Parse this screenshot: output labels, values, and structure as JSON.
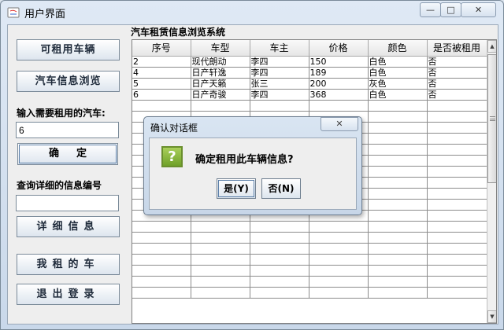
{
  "window": {
    "title": "用户界面",
    "min_label": "—",
    "max_label": "□",
    "close_label": "✕"
  },
  "sidebar": {
    "available_button": "可租用车辆",
    "browse_button": "汽车信息浏览",
    "rent_prompt": "输入需要租用的汽车:",
    "rent_input_value": "6",
    "confirm_button": "确定",
    "query_prompt": "查询详细的信息编号",
    "query_input_value": "",
    "detail_button": "详细信息",
    "my_cars_button": "我租的车",
    "logout_button": "退出登录"
  },
  "table": {
    "title": "汽车租赁信息浏览系统",
    "columns": [
      "序号",
      "车型",
      "车主",
      "价格",
      "颜色",
      "是否被租用"
    ],
    "rows": [
      [
        "2",
        "现代朗动",
        "李四",
        "150",
        "白色",
        "否"
      ],
      [
        "4",
        "日产轩逸",
        "李四",
        "189",
        "白色",
        "否"
      ],
      [
        "5",
        "日产天籁",
        "张三",
        "200",
        "灰色",
        "否"
      ],
      [
        "6",
        "日产奇骏",
        "李四",
        "368",
        "白色",
        "否"
      ]
    ]
  },
  "dialog": {
    "title": "确认对话框",
    "close_label": "✕",
    "icon_glyph": "?",
    "message": "确定租用此车辆信息?",
    "yes_button": "是(Y)",
    "no_button": "否(N)"
  },
  "colors": {
    "titlebar": "#dfe9f5",
    "question_icon": "#8dbb3f"
  }
}
